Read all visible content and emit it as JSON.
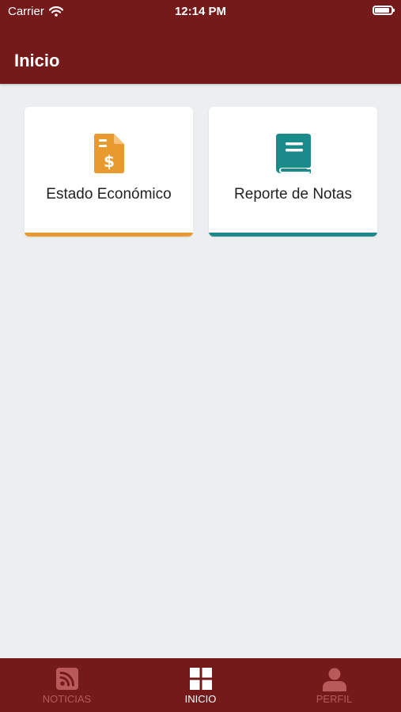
{
  "status_bar": {
    "carrier": "Carrier",
    "time": "12:14 PM"
  },
  "header": {
    "title": "Inicio"
  },
  "cards": [
    {
      "label": "Estado Económico",
      "icon": "invoice-dollar-icon",
      "accent_color": "#e89a2e"
    },
    {
      "label": "Reporte de Notas",
      "icon": "book-icon",
      "accent_color": "#1a8a8a"
    }
  ],
  "tab_bar": {
    "active_color": "#ffffff",
    "inactive_color": "#b85a5a",
    "tabs": [
      {
        "label": "NOTICIAS",
        "icon": "rss-icon",
        "active": false
      },
      {
        "label": "INICIO",
        "icon": "grid-icon",
        "active": true
      },
      {
        "label": "PERFIL",
        "icon": "user-icon",
        "active": false
      }
    ]
  },
  "colors": {
    "primary": "#741a1a",
    "background": "#eceef0"
  }
}
